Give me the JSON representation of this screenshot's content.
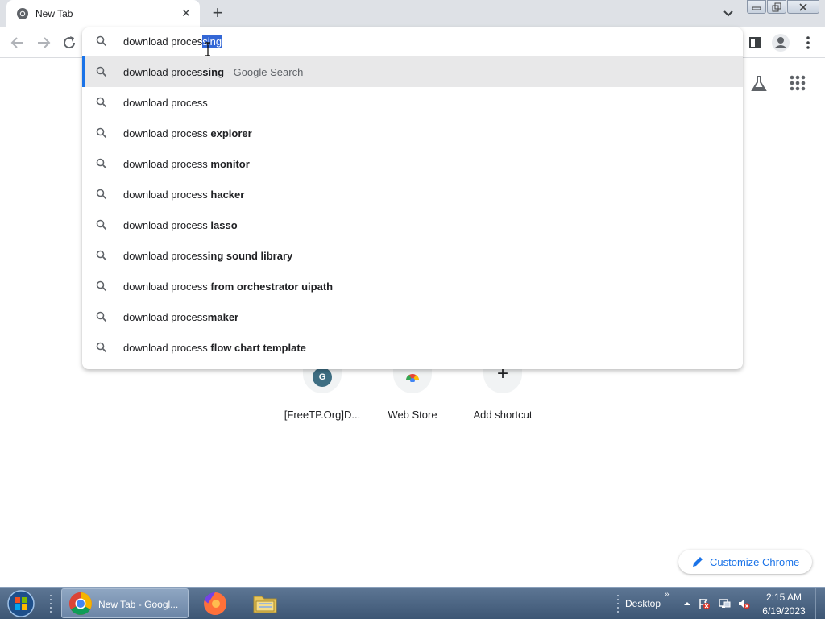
{
  "browser": {
    "tab": {
      "title": "New Tab",
      "favicon": "chrome-icon",
      "close_icon": "close-icon"
    },
    "new_tab_icon": "plus-icon",
    "tab_search_icon": "chevron-down-icon"
  },
  "omnibox": {
    "typed_text": "download proces",
    "selected_text": "sing",
    "suggestions": [
      {
        "prefix": "download processing",
        "bold": "",
        "suffix": " - Google Search",
        "active": true
      },
      {
        "prefix": "download process",
        "bold": "",
        "suffix": ""
      },
      {
        "prefix": "download process ",
        "bold": "explorer",
        "suffix": ""
      },
      {
        "prefix": "download process ",
        "bold": "monitor",
        "suffix": ""
      },
      {
        "prefix": "download process ",
        "bold": "hacker",
        "suffix": ""
      },
      {
        "prefix": "download process ",
        "bold": "lasso",
        "suffix": ""
      },
      {
        "prefix": "download process",
        "bold": "ing sound library",
        "suffix": ""
      },
      {
        "prefix": "download process ",
        "bold": "from orchestrator uipath",
        "suffix": ""
      },
      {
        "prefix": "download process",
        "bold": "maker",
        "suffix": ""
      },
      {
        "prefix": "download process ",
        "bold": "flow chart template",
        "suffix": ""
      }
    ],
    "first_suggestion_bold_part": "ing"
  },
  "ntp": {
    "shortcuts": [
      {
        "label": "[FreeTP.Org]D...",
        "avatar_letter": "G"
      },
      {
        "label": "Web Store"
      },
      {
        "label": "Add shortcut"
      }
    ],
    "customize_label": "Customize Chrome"
  },
  "taskbar": {
    "chrome_task_label": "New Tab - Googl...",
    "desktop_label": "Desktop",
    "desktop_chevron": "»",
    "time": "2:15 AM",
    "date": "6/19/2023"
  },
  "colors": {
    "accent": "#1a73e8",
    "selection": "#3367d6",
    "taskbar": "#4a6382"
  }
}
